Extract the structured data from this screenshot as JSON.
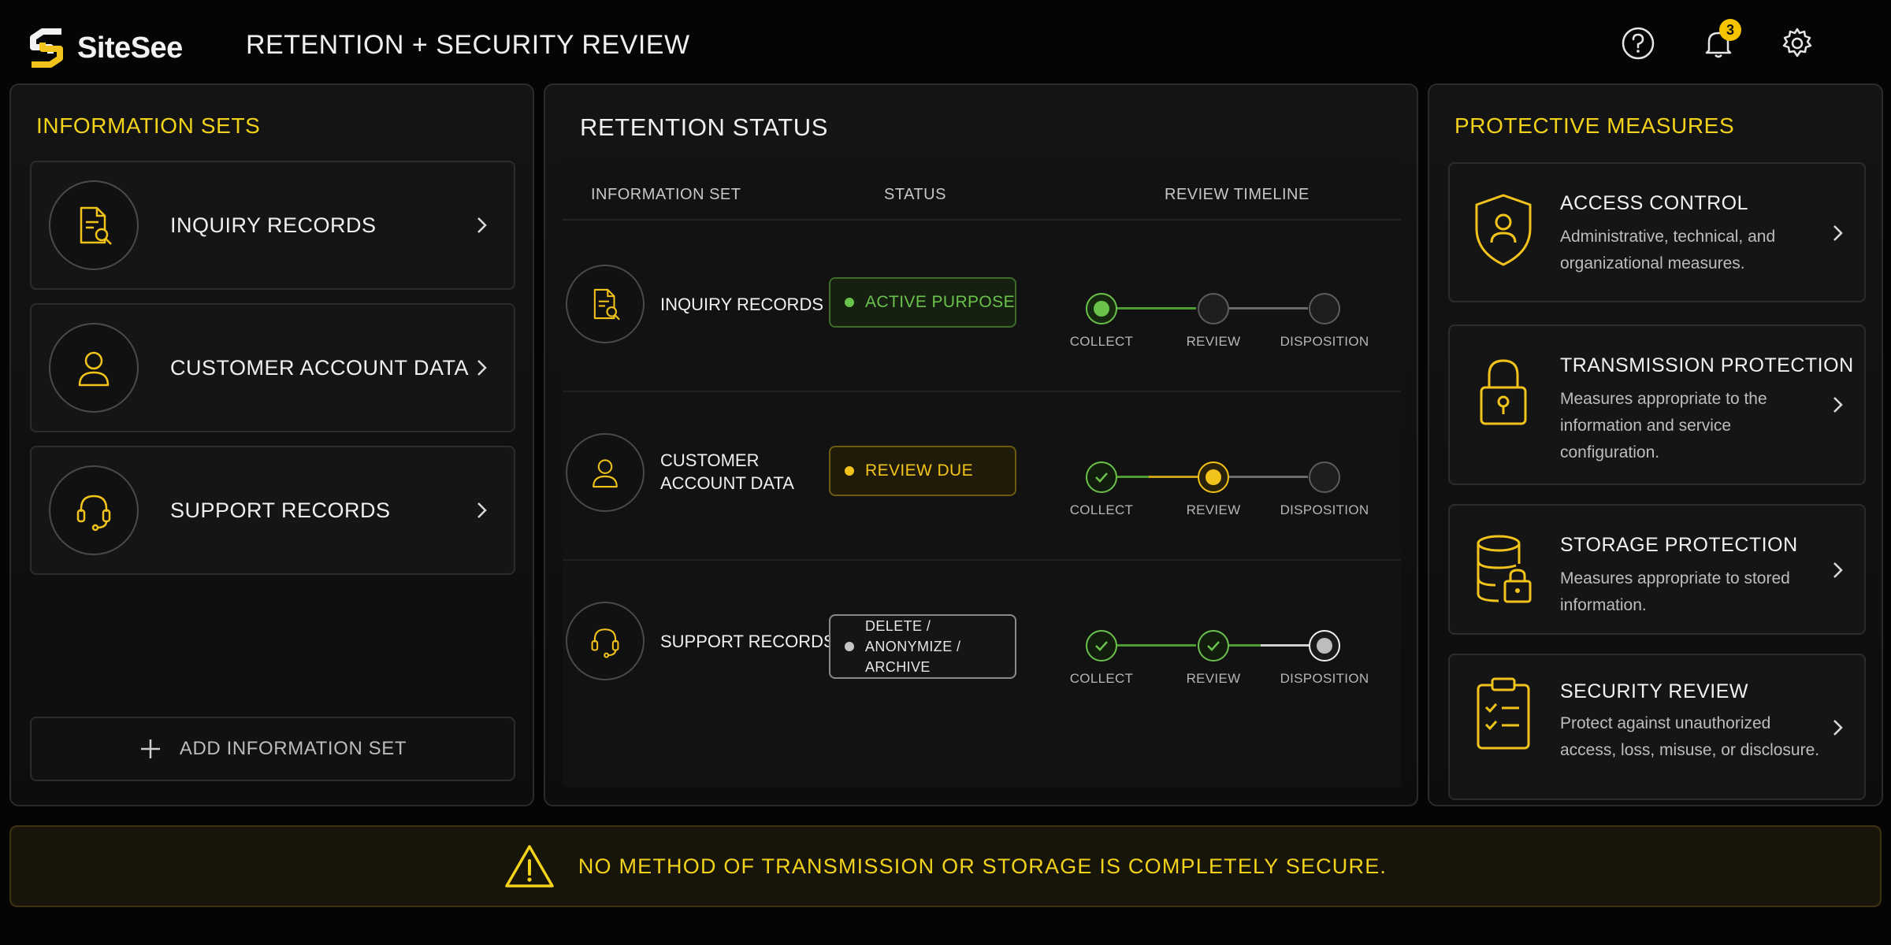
{
  "app": {
    "brand": "SiteSee",
    "title": "RETENTION + SECURITY REVIEW",
    "notification_count": "3",
    "accent_color": "#f2d21b"
  },
  "header_icons": [
    "help-icon",
    "bell-icon",
    "gear-icon"
  ],
  "information_sets": {
    "heading": "INFORMATION SETS",
    "items": [
      {
        "label": "INQUIRY RECORDS",
        "icon": "document-search-icon"
      },
      {
        "label": "CUSTOMER ACCOUNT DATA",
        "icon": "user-icon"
      },
      {
        "label": "SUPPORT RECORDS",
        "icon": "headset-icon"
      }
    ],
    "add_label": "ADD INFORMATION SET"
  },
  "retention_status": {
    "heading": "RETENTION STATUS",
    "columns": [
      "INFORMATION SET",
      "STATUS",
      "REVIEW TIMELINE"
    ],
    "timeline_steps": [
      "COLLECT",
      "REVIEW",
      "DISPOSITION"
    ],
    "rows": [
      {
        "label": "INQUIRY RECORDS",
        "status": "ACTIVE PURPOSE",
        "status_color": "#6ac24b",
        "timeline_state": [
          "current",
          "pending",
          "pending"
        ]
      },
      {
        "label": "CUSTOMER ACCOUNT DATA",
        "label_lines": [
          "CUSTOMER",
          "ACCOUNT DATA"
        ],
        "status": "REVIEW DUE",
        "status_color": "#f2c41b",
        "timeline_state": [
          "done",
          "current",
          "pending"
        ]
      },
      {
        "label": "SUPPORT RECORDS",
        "status": "DELETE / ANONYMIZE / ARCHIVE",
        "status_lines": [
          "DELETE / ANONYMIZE /",
          "ARCHIVE"
        ],
        "status_color": "#c4c4c4",
        "timeline_state": [
          "done",
          "done",
          "current"
        ]
      }
    ]
  },
  "protective_measures": {
    "heading": "PROTECTIVE MEASURES",
    "items": [
      {
        "title": "ACCESS CONTROL",
        "desc": "Administrative, technical, and organizational measures.",
        "icon": "shield-user-icon"
      },
      {
        "title": "TRANSMISSION PROTECTION",
        "desc": "Measures appropriate to the information and service configuration.",
        "icon": "padlock-icon"
      },
      {
        "title": "STORAGE PROTECTION",
        "desc": "Measures appropriate to stored information.",
        "icon": "database-lock-icon"
      },
      {
        "title": "SECURITY REVIEW",
        "desc": "Protect against unauthorized access, loss, misuse, or disclosure.",
        "icon": "clipboard-checklist-icon"
      }
    ]
  },
  "banner": {
    "text": "NO METHOD OF TRANSMISSION OR STORAGE IS COMPLETELY SECURE.",
    "icon": "warning-icon"
  }
}
